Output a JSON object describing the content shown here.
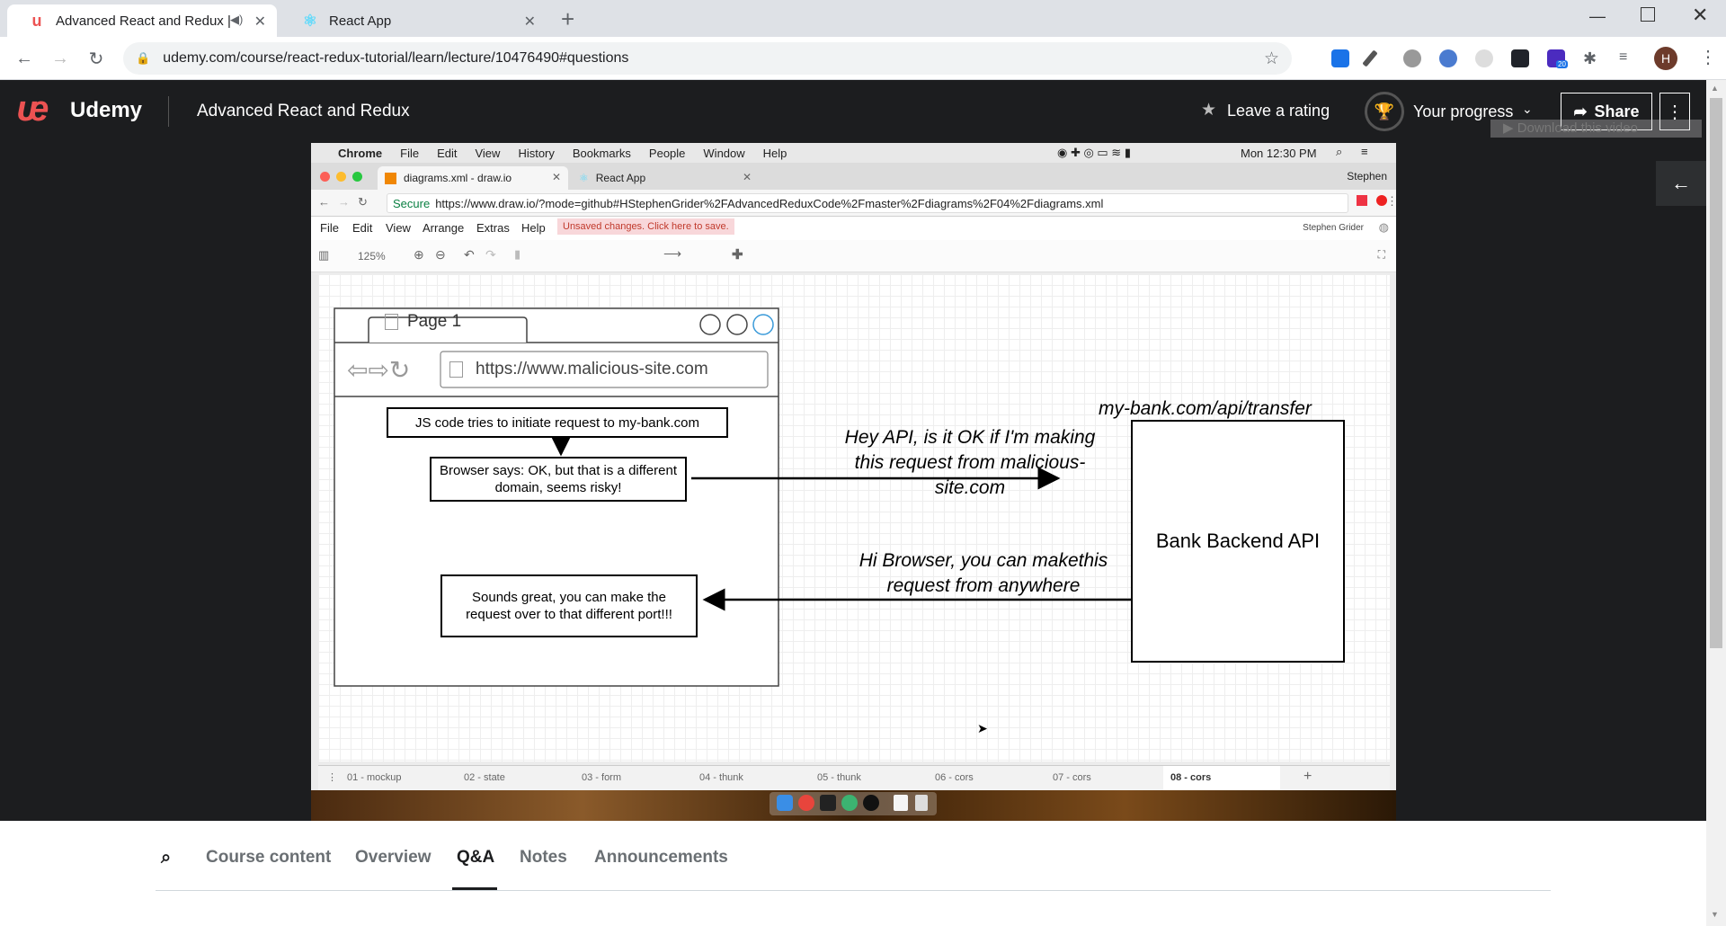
{
  "browser": {
    "tabs": [
      {
        "title": "Advanced React and Redux |",
        "active": true
      },
      {
        "title": "React App",
        "active": false
      }
    ],
    "url": "udemy.com/course/react-redux-tutorial/learn/lecture/10476490#questions",
    "profile_initial": "H",
    "badge_count": "20"
  },
  "udemy": {
    "logo_text": "Udemy",
    "course_title": "Advanced React and Redux",
    "leave_rating": "Leave a rating",
    "your_progress": "Your progress",
    "share": "Share",
    "download_video": "Download this video"
  },
  "mac": {
    "menu": [
      "Chrome",
      "File",
      "Edit",
      "View",
      "History",
      "Bookmarks",
      "People",
      "Window",
      "Help"
    ],
    "clock": "Mon 12:30 PM",
    "user": "Stephen",
    "tabs": [
      "diagrams.xml - draw.io",
      "React App"
    ],
    "secure": "Secure",
    "url": "https://www.draw.io/?mode=github#HStephenGrider%2FAdvancedReduxCode%2Fmaster%2Fdiagrams%2F04%2Fdiagrams.xml",
    "drawio_menu": [
      "File",
      "Edit",
      "View",
      "Arrange",
      "Extras",
      "Help"
    ],
    "unsaved": "Unsaved changes. Click here to save.",
    "account": "Stephen Grider",
    "zoom": "125%",
    "page_tabs": [
      "01 - mockup",
      "02 - state",
      "03 - form",
      "04 - thunk",
      "05 - thunk",
      "06 - cors",
      "07 - cors",
      "08 - cors"
    ]
  },
  "diagram": {
    "page_tab": "Page 1",
    "mock_url": "https://www.malicious-site.com",
    "box1": "JS code tries to initiate request to my-bank.com",
    "box2": "Browser says:  OK, but that is a different domain, seems risky!",
    "box3": "Sounds great, you can make the request over to that different port!!!",
    "bank_label": "my-bank.com/api/transfer",
    "bank_box": "Bank Backend API",
    "msg_request": "Hey API, is it OK if I'm making this request from malicious-site.com",
    "msg_response": "Hi Browser, you can makethis request from anywhere"
  },
  "lower_tabs": [
    "Course content",
    "Overview",
    "Q&A",
    "Notes",
    "Announcements"
  ],
  "active_lower_tab": "Q&A",
  "colors": {
    "udemy_dark": "#1c1d1f",
    "udemy_red": "#ec5252"
  }
}
